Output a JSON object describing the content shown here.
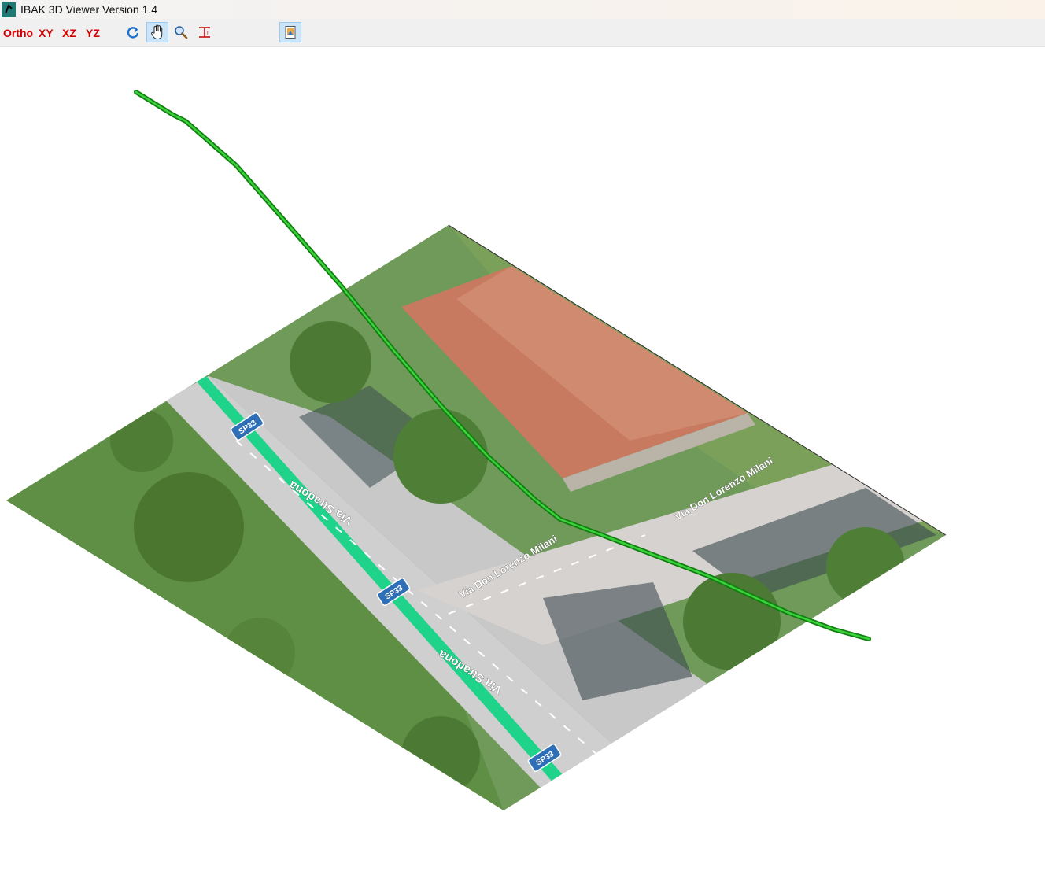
{
  "window": {
    "title": "IBAK 3D Viewer Version 1.4",
    "icon": "ibak-app-icon"
  },
  "toolbar": {
    "ortho": "Ortho",
    "xy": "XY",
    "xz": "XZ",
    "yz": "YZ",
    "tools": [
      {
        "icon": "refresh-icon",
        "active": false
      },
      {
        "icon": "hand-pan-icon",
        "active": true
      },
      {
        "icon": "zoom-icon",
        "active": false
      },
      {
        "icon": "text-marker-icon",
        "active": false
      },
      {
        "icon": "export-icon",
        "active": true
      }
    ]
  },
  "map": {
    "road_main": "Via Stradona",
    "road_side": "Via Don Lorenzo Milani",
    "road_badge": "SP33"
  },
  "colors": {
    "pipe": "#22b322",
    "road_highlight": "#1fd38a",
    "toolbar_text": "#d40000",
    "roof": "#c77a60",
    "grass": "#5f8f45"
  }
}
